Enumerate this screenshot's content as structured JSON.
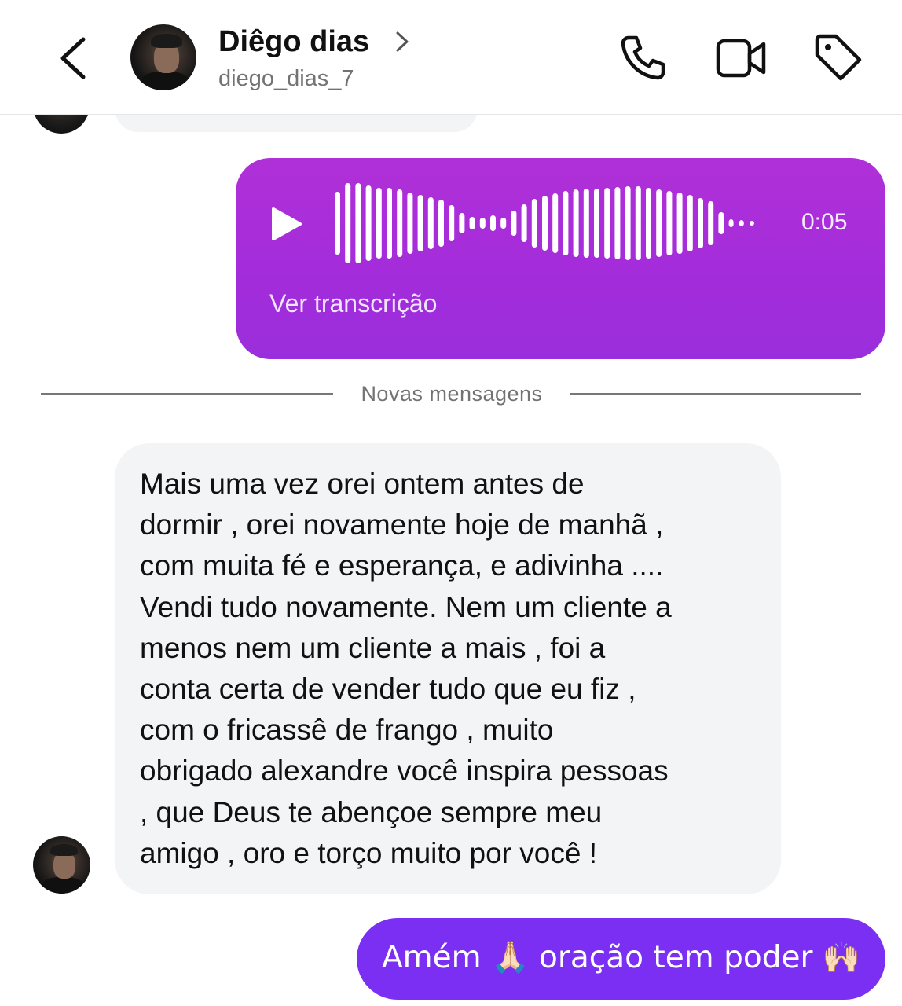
{
  "header": {
    "contact_name": "Diêgo dias",
    "contact_handle": "diego_dias_7"
  },
  "icons": {
    "back": "chevron-left-icon",
    "name_chevron": "chevron-right-icon",
    "phone": "phone-icon",
    "video": "video-camera-icon",
    "tag": "tag-icon",
    "play": "play-icon"
  },
  "colors": {
    "audio_bubble": "#a82fdb",
    "sent_bubble": "#7a2ff2",
    "received_bubble": "#f3f4f6"
  },
  "conversation": {
    "audio_message": {
      "duration": "0:05",
      "transcript_label": "Ver transcrição"
    },
    "divider_label": "Novas mensagens",
    "received_message": {
      "text": "Mais uma vez orei ontem antes de\ndormir , orei novamente hoje de manhã ,\ncom muita fé e esperança, e adivinha ....\nVendi tudo novamente. Nem um cliente a\nmenos nem um cliente a mais , foi a\nconta certa de vender tudo que eu fiz ,\ncom o fricassê de frango , muito\nobrigado alexandre você inspira pessoas\n, que Deus te abençoe sempre meu\namigo , oro e torço muito por você !"
    },
    "sent_message": {
      "text": "Amém 🙏🏻 oração tem poder 🙌🏻"
    }
  }
}
